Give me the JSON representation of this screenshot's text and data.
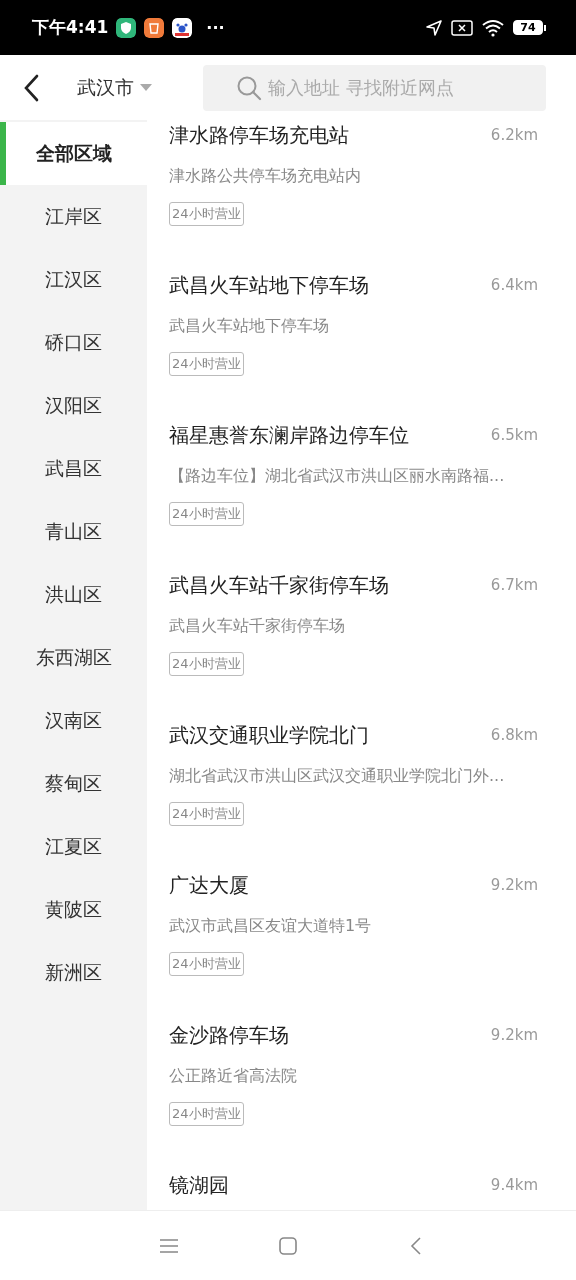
{
  "status_bar": {
    "time": "下午4:41",
    "more": "···",
    "battery": "74"
  },
  "header": {
    "city": "武汉市",
    "search": {
      "placeholder": "输入地址 寻找附近网点"
    }
  },
  "districts": [
    {
      "label": "全部区域",
      "selected": true
    },
    {
      "label": "江岸区",
      "selected": false
    },
    {
      "label": "江汉区",
      "selected": false
    },
    {
      "label": "硚口区",
      "selected": false
    },
    {
      "label": "汉阳区",
      "selected": false
    },
    {
      "label": "武昌区",
      "selected": false
    },
    {
      "label": "青山区",
      "selected": false
    },
    {
      "label": "洪山区",
      "selected": false
    },
    {
      "label": "东西湖区",
      "selected": false
    },
    {
      "label": "汉南区",
      "selected": false
    },
    {
      "label": "蔡甸区",
      "selected": false
    },
    {
      "label": "江夏区",
      "selected": false
    },
    {
      "label": "黄陂区",
      "selected": false
    },
    {
      "label": "新洲区",
      "selected": false
    }
  ],
  "stations": [
    {
      "name": "津水路停车场充电站",
      "distance": "6.2km",
      "address": "津水路公共停车场充电站内",
      "tag": "24小时营业"
    },
    {
      "name": "武昌火车站地下停车场",
      "distance": "6.4km",
      "address": "武昌火车站地下停车场",
      "tag": "24小时营业"
    },
    {
      "name": "福星惠誉东澜岸路边停车位",
      "distance": "6.5km",
      "address": "【路边车位】湖北省武汉市洪山区丽水南路福...",
      "tag": "24小时营业"
    },
    {
      "name": "武昌火车站千家街停车场",
      "distance": "6.7km",
      "address": "武昌火车站千家街停车场",
      "tag": "24小时营业"
    },
    {
      "name": "武汉交通职业学院北门",
      "distance": "6.8km",
      "address": "湖北省武汉市洪山区武汉交通职业学院北门外...",
      "tag": "24小时营业"
    },
    {
      "name": "广达大厦",
      "distance": "9.2km",
      "address": "武汉市武昌区友谊大道特1号",
      "tag": "24小时营业"
    },
    {
      "name": "金沙路停车场",
      "distance": "9.2km",
      "address": "公正路近省高法院",
      "tag": "24小时营业"
    },
    {
      "name": "镜湖园",
      "distance": "9.4km"
    }
  ]
}
